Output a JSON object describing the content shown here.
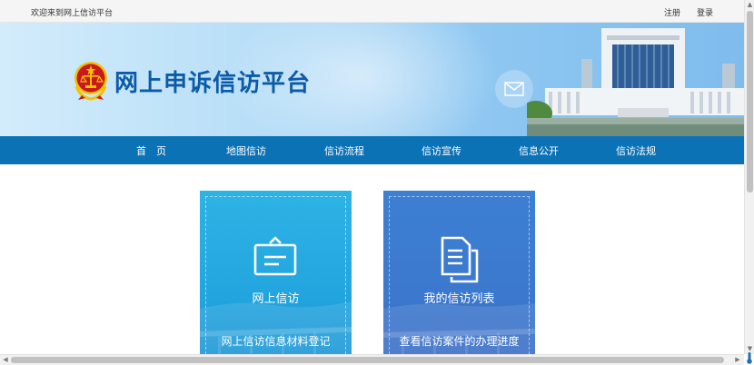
{
  "topbar": {
    "welcome": "欢迎来到网上信访平台",
    "register": "注册",
    "login": "登录"
  },
  "banner": {
    "title": "网上申诉信访平台",
    "emblem_icon": "court-emblem-icon",
    "mail_icon": "envelope-icon"
  },
  "nav": {
    "items": [
      {
        "label": "首　页"
      },
      {
        "label": "地图信访"
      },
      {
        "label": "信访流程"
      },
      {
        "label": "信访宣传"
      },
      {
        "label": "信息公开"
      },
      {
        "label": "信访法规"
      }
    ]
  },
  "cards": [
    {
      "icon": "envelope-form-icon",
      "title": "网上信访",
      "subtitle": "网上信访信息材料登记",
      "color": "#23a6df"
    },
    {
      "icon": "documents-icon",
      "title": "我的信访列表",
      "subtitle": "查看信访案件的办理进度",
      "color": "#3b79cf"
    }
  ],
  "colors": {
    "nav_bg": "#0c72b6",
    "title": "#0d5ba8",
    "emblem_red": "#c8191e",
    "emblem_gold": "#f2c300"
  }
}
